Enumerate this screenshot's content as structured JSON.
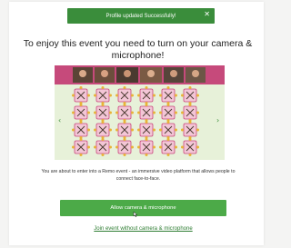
{
  "toast": {
    "message": "Profile updated Successfully!",
    "close_glyph": "✕"
  },
  "headline": "To enjoy this event you need to turn on your camera & microphone!",
  "description": "You are about to enter into a Remo event - an immersive video platform that allows people to connect face-to-face.",
  "primary_button": {
    "label": "Allow camera & microphone"
  },
  "secondary_link": {
    "label": "Join event without camera & microphone"
  },
  "venue_preview": {
    "icons": {
      "prev": "chevron-left-icon",
      "next": "chevron-right-icon"
    },
    "colors": {
      "floor": "#e7f1d9",
      "table_top": "#f3c6d6",
      "table_edge": "#c9467b",
      "seat": "#e9b338",
      "video_bg": "#5a4436",
      "banner": "#c64a7b"
    }
  },
  "theme": {
    "accent": "#4caa48",
    "toast": "#3a8d3b",
    "link": "#2e7d32"
  }
}
